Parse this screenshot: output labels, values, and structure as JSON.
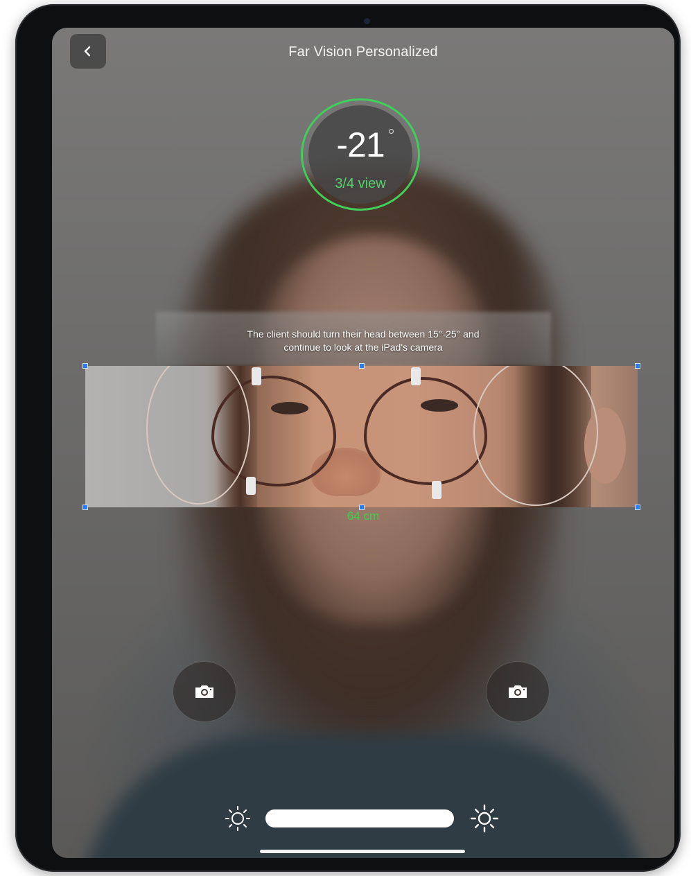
{
  "header": {
    "title": "Far Vision Personalized",
    "back_icon": "chevron-left-icon"
  },
  "angle_indicator": {
    "value": "-21",
    "view_label": "3/4 view",
    "ring_color": "#3fcf5a"
  },
  "instruction": {
    "line1": "The client should turn their head between 15°-25° and",
    "line2": "continue to look at the iPad's camera"
  },
  "measurement": {
    "distance_label": "64 cm",
    "label_color": "#37d24e",
    "handle_color": "#2b7cf0"
  },
  "controls": {
    "left_capture_icon": "camera-icon",
    "right_capture_icon": "camera-icon",
    "brightness_low_icon": "sun-icon",
    "brightness_high_icon": "sun-icon"
  }
}
